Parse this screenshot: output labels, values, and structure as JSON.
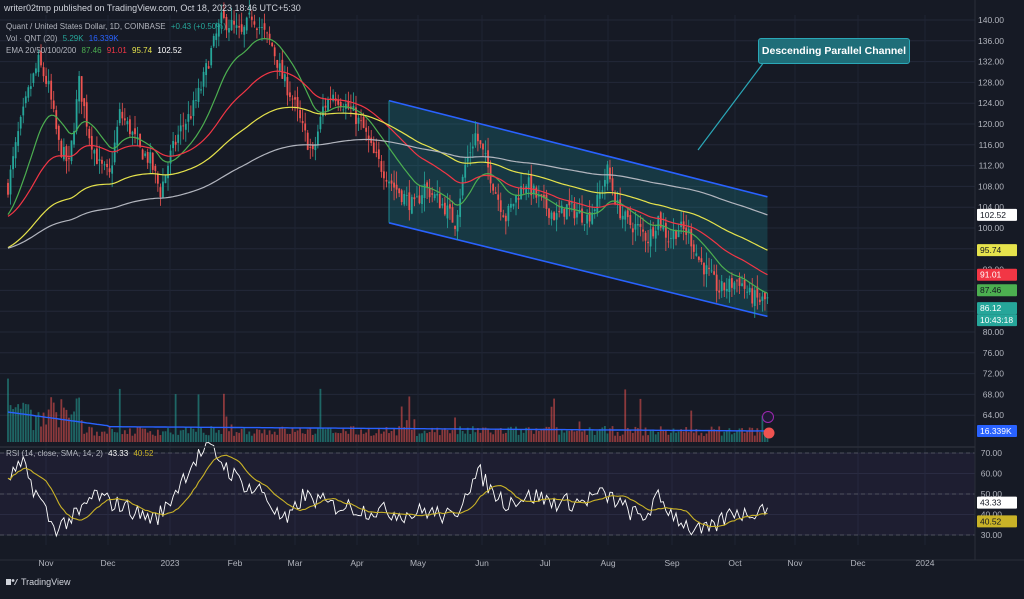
{
  "header": {
    "author_line": "writer02tmp published on TradingView.com, Oct 18, 2023 18:46 UTC+5:30",
    "symbol_line": "Quant / United States Dollar, 1D, COINBASE",
    "ohlc_change": "+0.43 (+0.50%)",
    "vol_line": "Vol · QNT (20)",
    "vol_values": [
      "5.29K",
      "16.339K"
    ],
    "ema_line": "EMA 20/50/100/200",
    "ema_values": [
      "87.46",
      "91.01",
      "95.74",
      "102.52"
    ],
    "rsi_line": "RSI (14, close, SMA, 14, 2)",
    "rsi_values": [
      "43.33",
      "40.52"
    ]
  },
  "annotation": {
    "label": "Descending Parallel Channel"
  },
  "brand": {
    "label": "TradingView"
  },
  "colors": {
    "up": "#26a69a",
    "down": "#ef5350",
    "ema20": "#4caf50",
    "ema50": "#f23645",
    "ema100": "#e6e34c",
    "ema200": "#b2b5be",
    "channel_line": "#2962ff",
    "channel_fill": "#1e8a93",
    "volume_ma": "#2962ff",
    "rsi": "#ffffff",
    "rsi_ma": "#c9b227",
    "annotation_bg": "#1f6e79"
  },
  "chart_data": {
    "type": "candlestick",
    "price_axis": {
      "min": 76,
      "max": 140,
      "ticks": [
        140,
        136,
        132,
        128,
        124,
        120,
        116,
        112,
        108,
        104,
        100,
        96,
        92,
        88,
        84,
        80,
        76,
        72,
        68,
        64
      ]
    },
    "time_axis": {
      "labels": [
        "Nov",
        "Dec",
        "2023",
        "Feb",
        "Mar",
        "Apr",
        "May",
        "Jun",
        "Jul",
        "Aug",
        "Sep",
        "Oct",
        "Nov",
        "Dec",
        "2024"
      ]
    },
    "close_anchors": [
      [
        0,
        108
      ],
      [
        4,
        118
      ],
      [
        8,
        126
      ],
      [
        12,
        132
      ],
      [
        16,
        127
      ],
      [
        20,
        116
      ],
      [
        24,
        112
      ],
      [
        28,
        128
      ],
      [
        32,
        118
      ],
      [
        36,
        112
      ],
      [
        40,
        110
      ],
      [
        44,
        122
      ],
      [
        48,
        119
      ],
      [
        52,
        115
      ],
      [
        56,
        113
      ],
      [
        60,
        107
      ],
      [
        64,
        114
      ],
      [
        68,
        119
      ],
      [
        72,
        122
      ],
      [
        76,
        127
      ],
      [
        80,
        134
      ],
      [
        84,
        140
      ],
      [
        88,
        139
      ],
      [
        92,
        137
      ],
      [
        96,
        141
      ],
      [
        100,
        138
      ],
      [
        104,
        135
      ],
      [
        108,
        129
      ],
      [
        112,
        125
      ],
      [
        116,
        119
      ],
      [
        120,
        114
      ],
      [
        124,
        123
      ],
      [
        128,
        126
      ],
      [
        132,
        124
      ],
      [
        136,
        122
      ],
      [
        140,
        119
      ],
      [
        144,
        114
      ],
      [
        148,
        111
      ],
      [
        152,
        108
      ],
      [
        156,
        106
      ],
      [
        160,
        104
      ],
      [
        164,
        108
      ],
      [
        168,
        106
      ],
      [
        172,
        104
      ],
      [
        176,
        101
      ],
      [
        180,
        112
      ],
      [
        184,
        118
      ],
      [
        188,
        113
      ],
      [
        192,
        107
      ],
      [
        196,
        102
      ],
      [
        200,
        106
      ],
      [
        204,
        109
      ],
      [
        208,
        106
      ],
      [
        212,
        104
      ],
      [
        216,
        102
      ],
      [
        220,
        104
      ],
      [
        224,
        103
      ],
      [
        228,
        102
      ],
      [
        232,
        105
      ],
      [
        236,
        111
      ],
      [
        240,
        104
      ],
      [
        244,
        101
      ],
      [
        248,
        100
      ],
      [
        252,
        98
      ],
      [
        256,
        102
      ],
      [
        260,
        98
      ],
      [
        264,
        100
      ],
      [
        268,
        99
      ],
      [
        272,
        94
      ],
      [
        276,
        91
      ],
      [
        280,
        88
      ],
      [
        284,
        89
      ],
      [
        288,
        90
      ],
      [
        292,
        87
      ],
      [
        296,
        86
      ],
      [
        299,
        86.12
      ]
    ],
    "ema_last": {
      "ema20": 87.46,
      "ema50": 91.01,
      "ema100": 95.74,
      "ema200": 102.52
    },
    "last_price": 86.12,
    "countdown": "10:43:18",
    "channel": {
      "upper": [
        [
          150,
          124.5
        ],
        [
          299,
          106
        ]
      ],
      "lower": [
        [
          150,
          101
        ],
        [
          299,
          83
        ]
      ]
    },
    "volume": {
      "last_ma": "16.339K",
      "scale_ticks": []
    },
    "rsi": {
      "ticks": [
        70,
        60,
        50,
        40,
        30
      ],
      "tick_labels": [
        "70.00",
        "60.00",
        "50.00",
        "40.00",
        "30.00"
      ],
      "anchors": [
        [
          0,
          58
        ],
        [
          6,
          64
        ],
        [
          10,
          53
        ],
        [
          14,
          44
        ],
        [
          18,
          33
        ],
        [
          22,
          36
        ],
        [
          28,
          40
        ],
        [
          34,
          50
        ],
        [
          40,
          46
        ],
        [
          46,
          44
        ],
        [
          52,
          40
        ],
        [
          58,
          38
        ],
        [
          62,
          43
        ],
        [
          68,
          56
        ],
        [
          72,
          64
        ],
        [
          76,
          70
        ],
        [
          80,
          72
        ],
        [
          84,
          66
        ],
        [
          88,
          60
        ],
        [
          92,
          56
        ],
        [
          96,
          52
        ],
        [
          100,
          52
        ],
        [
          106,
          40
        ],
        [
          110,
          36
        ],
        [
          116,
          49
        ],
        [
          122,
          47
        ],
        [
          128,
          44
        ],
        [
          134,
          44
        ],
        [
          140,
          42
        ],
        [
          146,
          42
        ],
        [
          152,
          41
        ],
        [
          158,
          40
        ],
        [
          164,
          42
        ],
        [
          170,
          40
        ],
        [
          176,
          38
        ],
        [
          180,
          52
        ],
        [
          186,
          60
        ],
        [
          190,
          52
        ],
        [
          196,
          46
        ],
        [
          202,
          48
        ],
        [
          208,
          49
        ],
        [
          214,
          46
        ],
        [
          220,
          46
        ],
        [
          226,
          46
        ],
        [
          232,
          50
        ],
        [
          238,
          48
        ],
        [
          244,
          42
        ],
        [
          250,
          38
        ],
        [
          256,
          48
        ],
        [
          262,
          40
        ],
        [
          266,
          36
        ],
        [
          270,
          32
        ],
        [
          276,
          32
        ],
        [
          280,
          36
        ],
        [
          286,
          42
        ],
        [
          290,
          40
        ],
        [
          296,
          43
        ],
        [
          299,
          43.33
        ]
      ],
      "last": 43.33,
      "ma_last": 40.52
    }
  },
  "axis_badges": {
    "ema200": "102.52",
    "ema100": "95.74",
    "ema50": "91.01",
    "ema20": "87.46",
    "price": "86.12",
    "countdown": "10:43:18",
    "volume": "16.339K",
    "rsi": "43.33",
    "rsi_ma": "40.52"
  }
}
